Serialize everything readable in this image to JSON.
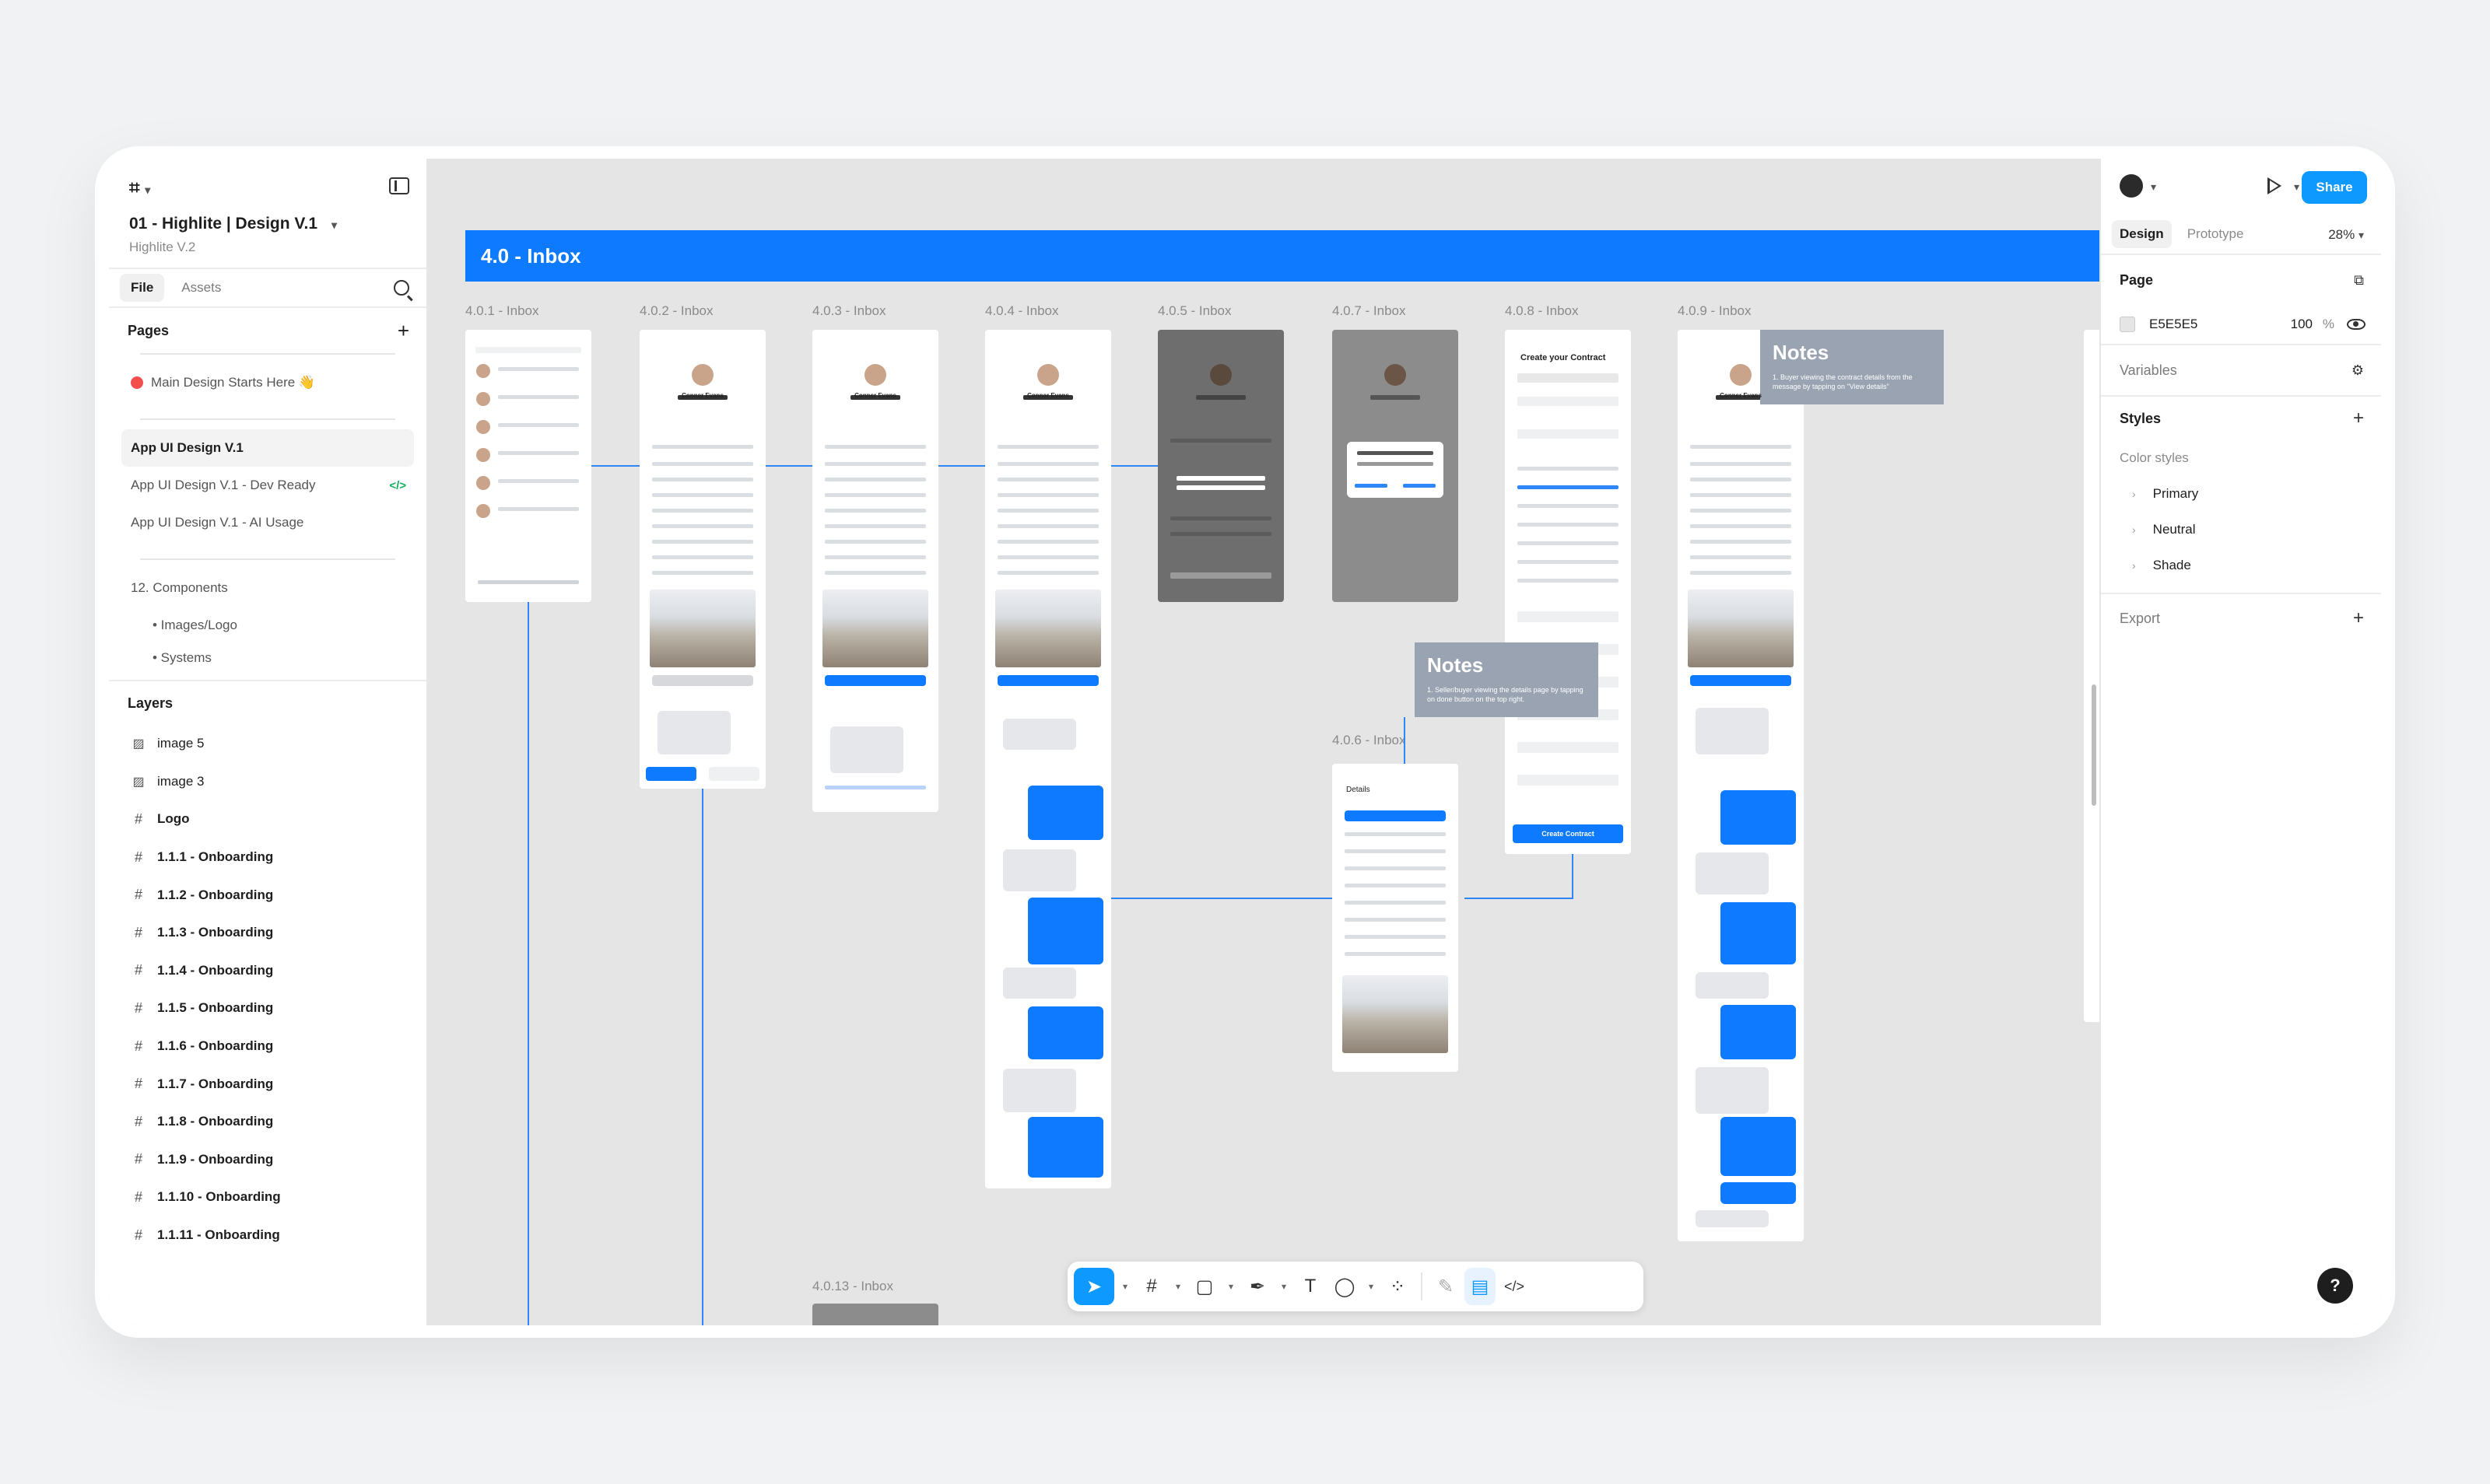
{
  "file": {
    "title": "01 - Highlite | Design V.1",
    "subtitle": "Highlite V.2"
  },
  "left_tabs": {
    "file": "File",
    "assets": "Assets"
  },
  "pages": {
    "heading": "Pages",
    "items": [
      {
        "label": "Main Design Starts Here 👋"
      },
      {
        "label": "App UI Design V.1"
      },
      {
        "label": "App UI Design V.1 - Dev Ready",
        "badge": "</>"
      },
      {
        "label": "App UI Design V.1 - AI Usage"
      },
      {
        "label": "12. Components"
      },
      {
        "label": "• Images/Logo"
      },
      {
        "label": "• Systems"
      }
    ]
  },
  "layers": {
    "heading": "Layers",
    "items": [
      {
        "label": "image 5",
        "kind": "image"
      },
      {
        "label": "image 3",
        "kind": "image"
      },
      {
        "label": "Logo",
        "kind": "frame"
      },
      {
        "label": "1.1.1 - Onboarding",
        "kind": "frame"
      },
      {
        "label": "1.1.2 - Onboarding",
        "kind": "frame"
      },
      {
        "label": "1.1.3 - Onboarding",
        "kind": "frame"
      },
      {
        "label": "1.1.4 - Onboarding",
        "kind": "frame"
      },
      {
        "label": "1.1.5 - Onboarding",
        "kind": "frame"
      },
      {
        "label": "1.1.6 - Onboarding",
        "kind": "frame"
      },
      {
        "label": "1.1.7 - Onboarding",
        "kind": "frame"
      },
      {
        "label": "1.1.8 - Onboarding",
        "kind": "frame"
      },
      {
        "label": "1.1.9 - Onboarding",
        "kind": "frame"
      },
      {
        "label": "1.1.10 - Onboarding",
        "kind": "frame"
      },
      {
        "label": "1.1.11 - Onboarding",
        "kind": "frame"
      }
    ]
  },
  "canvas": {
    "section_title": "4.0 - Inbox",
    "frames": [
      {
        "label": "4.0.1 - Inbox"
      },
      {
        "label": "4.0.2 - Inbox"
      },
      {
        "label": "4.0.3 - Inbox"
      },
      {
        "label": "4.0.4 - Inbox"
      },
      {
        "label": "4.0.5 - Inbox"
      },
      {
        "label": "4.0.7 - Inbox"
      },
      {
        "label": "4.0.8 - Inbox"
      },
      {
        "label": "4.0.9 - Inbox"
      },
      {
        "label": "4.0.6 - Inbox"
      },
      {
        "label": "4.0.13 - Inbox"
      }
    ],
    "notes": [
      {
        "title": "Notes",
        "text": "1. Buyer viewing the contract details from the message by tapping on \"View details\""
      },
      {
        "title": "Notes",
        "text": "1. Seller/buyer viewing the details page by tapping on done button on the top right."
      }
    ],
    "screen_texts": {
      "person": "Conner Evans",
      "contract_title": "Create your Contract",
      "create_contract": "Create Contract",
      "details": "Details"
    }
  },
  "right": {
    "share": "Share",
    "tabs": {
      "design": "Design",
      "prototype": "Prototype"
    },
    "zoom": "28%",
    "page": {
      "heading": "Page",
      "color": "E5E5E5",
      "opacity": "100",
      "unit": "%"
    },
    "variables": "Variables",
    "styles": {
      "heading": "Styles",
      "group": "Color styles",
      "items": [
        "Primary",
        "Neutral",
        "Shade"
      ]
    },
    "export": "Export",
    "help": "?"
  },
  "colors": {
    "accent": "#0d99ff",
    "banner": "#0d7aff",
    "canvas": "#e5e5e5"
  }
}
